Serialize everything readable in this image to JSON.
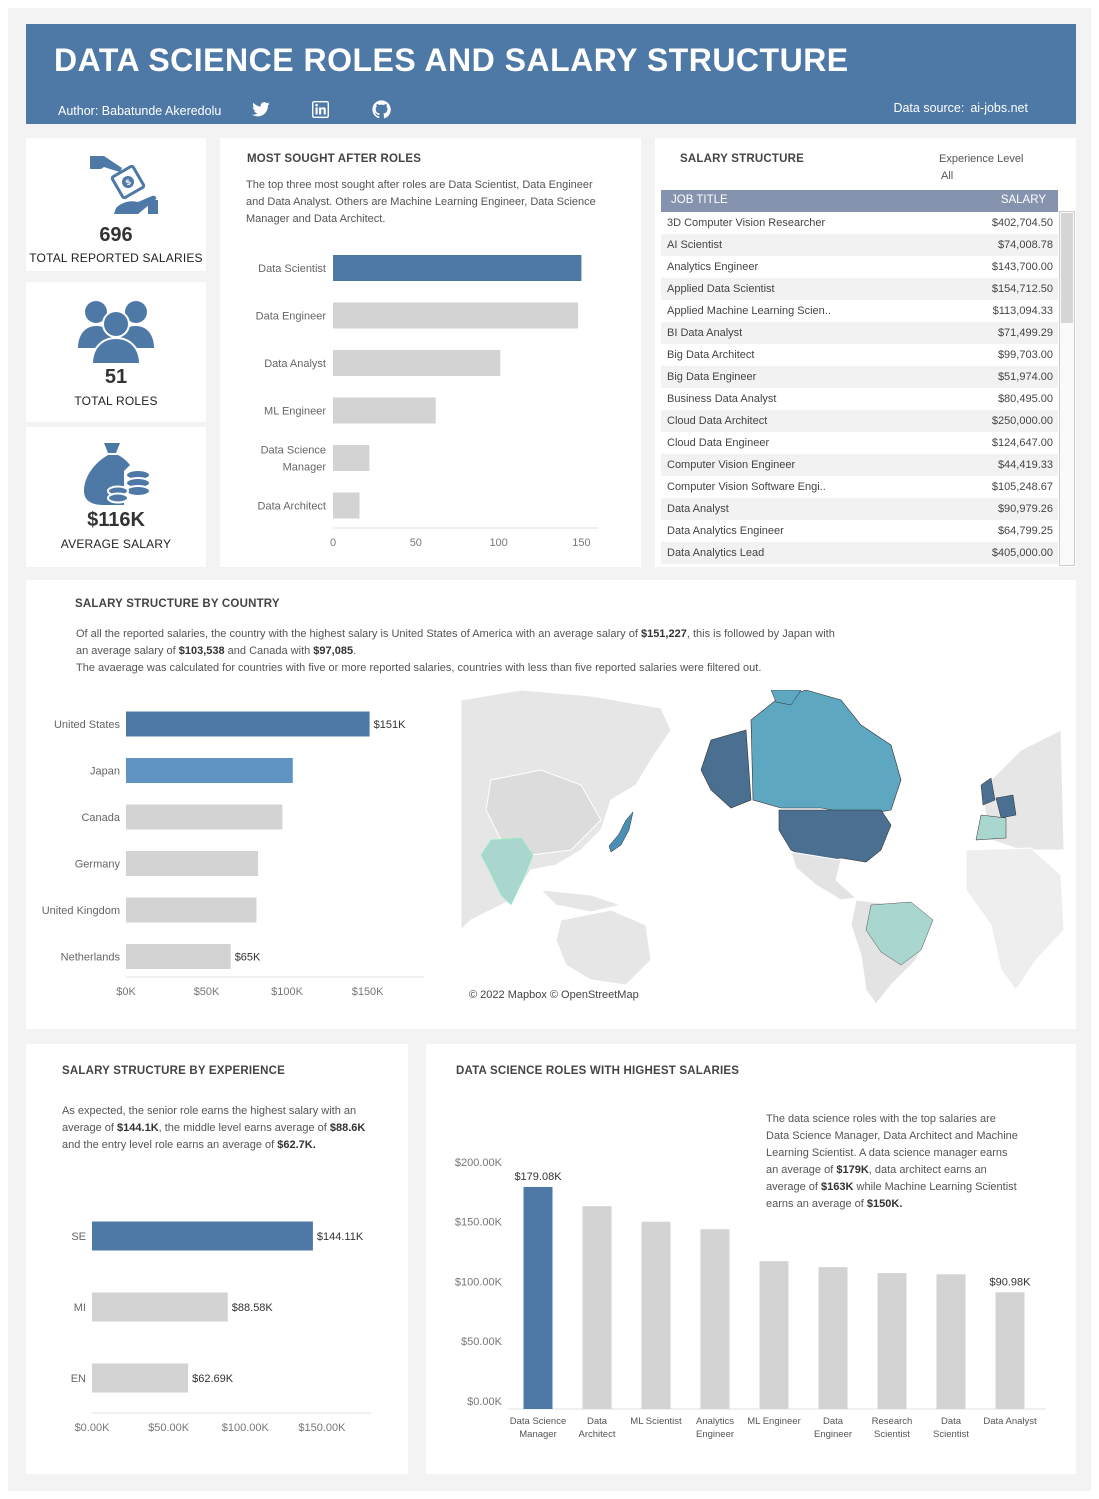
{
  "header": {
    "title": "DATA SCIENCE ROLES AND SALARY STRUCTURE",
    "author": "Author: Babatunde Akeredolu",
    "source_label": "Data source:",
    "source_value": "ai-jobs.net",
    "icons": [
      "twitter-icon",
      "linkedin-icon",
      "github-icon"
    ]
  },
  "kpis": [
    {
      "value": "696",
      "label": "TOTAL REPORTED SALARIES",
      "icon": "hand-money-icon"
    },
    {
      "value": "51",
      "label": "TOTAL ROLES",
      "icon": "people-icon"
    },
    {
      "value": "$116K",
      "label": "AVERAGE SALARY",
      "icon": "money-bag-icon"
    }
  ],
  "roles": {
    "title": "MOST SOUGHT AFTER ROLES",
    "description": "The top three most sought after roles are Data Scientist, Data Engineer and Data Analyst. Others are Machine Learning Engineer, Data Science Manager and Data Architect."
  },
  "salary_table": {
    "title": "SALARY STRUCTURE",
    "filter_label": "Experience Level",
    "filter_value": "All",
    "columns": [
      "JOB TITLE",
      "SALARY"
    ],
    "rows": [
      [
        "3D Computer Vision Researcher",
        "$402,704.50"
      ],
      [
        "AI Scientist",
        "$74,008.78"
      ],
      [
        "Analytics Engineer",
        "$143,700.00"
      ],
      [
        "Applied Data Scientist",
        "$154,712.50"
      ],
      [
        "Applied Machine Learning Scien..",
        "$113,094.33"
      ],
      [
        "BI Data Analyst",
        "$71,499.29"
      ],
      [
        "Big Data Architect",
        "$99,703.00"
      ],
      [
        "Big Data Engineer",
        "$51,974.00"
      ],
      [
        "Business Data Analyst",
        "$80,495.00"
      ],
      [
        "Cloud Data Architect",
        "$250,000.00"
      ],
      [
        "Cloud Data Engineer",
        "$124,647.00"
      ],
      [
        "Computer Vision Engineer",
        "$44,419.33"
      ],
      [
        "Computer Vision Software Engi..",
        "$105,248.67"
      ],
      [
        "Data Analyst",
        "$90,979.26"
      ],
      [
        "Data Analytics Engineer",
        "$64,799.25"
      ],
      [
        "Data Analytics Lead",
        "$405,000.00"
      ]
    ]
  },
  "country": {
    "title": "SALARY STRUCTURE BY COUNTRY",
    "desc_1": "Of all the reported salaries, the country with the highest salary is United States of America with an average salary of ",
    "desc_1b": "$151,227",
    "desc_1c": ", this is followed by Japan with",
    "desc_2": "an average salary of ",
    "desc_2b": "$103,538",
    "desc_2c": " and Canada with ",
    "desc_2d": "$97,085",
    "desc_2e": ".",
    "desc_3": "The avaerage was calculated for countries with five or more reported salaries, countries with less than five reported salaries were filtered out.",
    "map_credit": "© 2022 Mapbox © OpenStreetMap"
  },
  "experience": {
    "title": "SALARY STRUCTURE BY EXPERIENCE",
    "desc_a": "As expected, the senior role earns the highest salary with an average of ",
    "desc_b": "$144.1K",
    "desc_c": ", the middle level earns average of ",
    "desc_d": "$88.6K",
    "desc_e": " and the entry level role earns an average of ",
    "desc_f": "$62.7K."
  },
  "top_roles": {
    "title": "DATA SCIENCE ROLES WITH HIGHEST SALARIES",
    "desc_a": "The data science roles with the top salaries are Data Science Manager, Data Architect and Machine Learning Scientist. A data science manager earns an average of ",
    "desc_b": "$179K",
    "desc_c": ", data architect earns an average of ",
    "desc_d": "$163K",
    "desc_e": " while Machine Learning Scientist earns an average of ",
    "desc_f": "$150K."
  },
  "chart_data": [
    {
      "id": "roles",
      "type": "bar",
      "orientation": "horizontal",
      "categories": [
        "Data Scientist",
        "Data Engineer",
        "Data Analyst",
        "ML Engineer",
        "Data Science Manager",
        "Data Architect"
      ],
      "values": [
        150,
        148,
        101,
        62,
        22,
        16
      ],
      "xlim": [
        0,
        160
      ],
      "xticks": [
        "0",
        "50",
        "100",
        "150"
      ],
      "highlight": "#4e79a7",
      "base_color": "#d3d3d3"
    },
    {
      "id": "country",
      "type": "bar",
      "orientation": "horizontal",
      "categories": [
        "United States",
        "Japan",
        "Canada",
        "Germany",
        "United Kingdom",
        "Netherlands"
      ],
      "values": [
        151227,
        103538,
        97085,
        82000,
        81000,
        65000
      ],
      "labels": [
        "$151K",
        "",
        "",
        "",
        "",
        "$65K"
      ],
      "xlim": [
        0,
        185000
      ],
      "xticks": [
        "$0K",
        "$50K",
        "$100K",
        "$150K"
      ],
      "colors": [
        "#4e79a7",
        "#5f93c1",
        "#d3d3d3",
        "#d3d3d3",
        "#d3d3d3",
        "#d3d3d3"
      ]
    },
    {
      "id": "experience",
      "type": "bar",
      "orientation": "horizontal",
      "categories": [
        "SE",
        "MI",
        "EN"
      ],
      "values": [
        144.11,
        88.58,
        62.69
      ],
      "labels": [
        "$144.11K",
        "$88.58K",
        "$62.69K"
      ],
      "xlim": [
        0,
        182
      ],
      "xticks": [
        "$0.00K",
        "$50.00K",
        "$100.00K",
        "$150.00K"
      ],
      "colors": [
        "#4e79a7",
        "#d3d3d3",
        "#d3d3d3"
      ]
    },
    {
      "id": "top_roles",
      "type": "bar",
      "orientation": "vertical",
      "categories": [
        "Data Science Manager",
        "Data Architect",
        "ML Scientist",
        "Analytics Engineer",
        "ML Engineer",
        "Data Engineer",
        "Research Scientist",
        "Data Scientist",
        "Data Analyst"
      ],
      "values": [
        179.08,
        163,
        150,
        143.7,
        117,
        112,
        107,
        106,
        90.98
      ],
      "labels": [
        "$179.08K",
        "",
        "",
        "",
        "",
        "",
        "",
        "",
        "$90.98K"
      ],
      "ylim": [
        0,
        210
      ],
      "yticks": [
        "$0.00K",
        "$50.00K",
        "$100.00K",
        "$150.00K",
        "$200.00K"
      ],
      "colors": [
        "#4e79a7",
        "#d3d3d3",
        "#d3d3d3",
        "#d3d3d3",
        "#d3d3d3",
        "#d3d3d3",
        "#d3d3d3",
        "#d3d3d3",
        "#d3d3d3"
      ]
    }
  ]
}
